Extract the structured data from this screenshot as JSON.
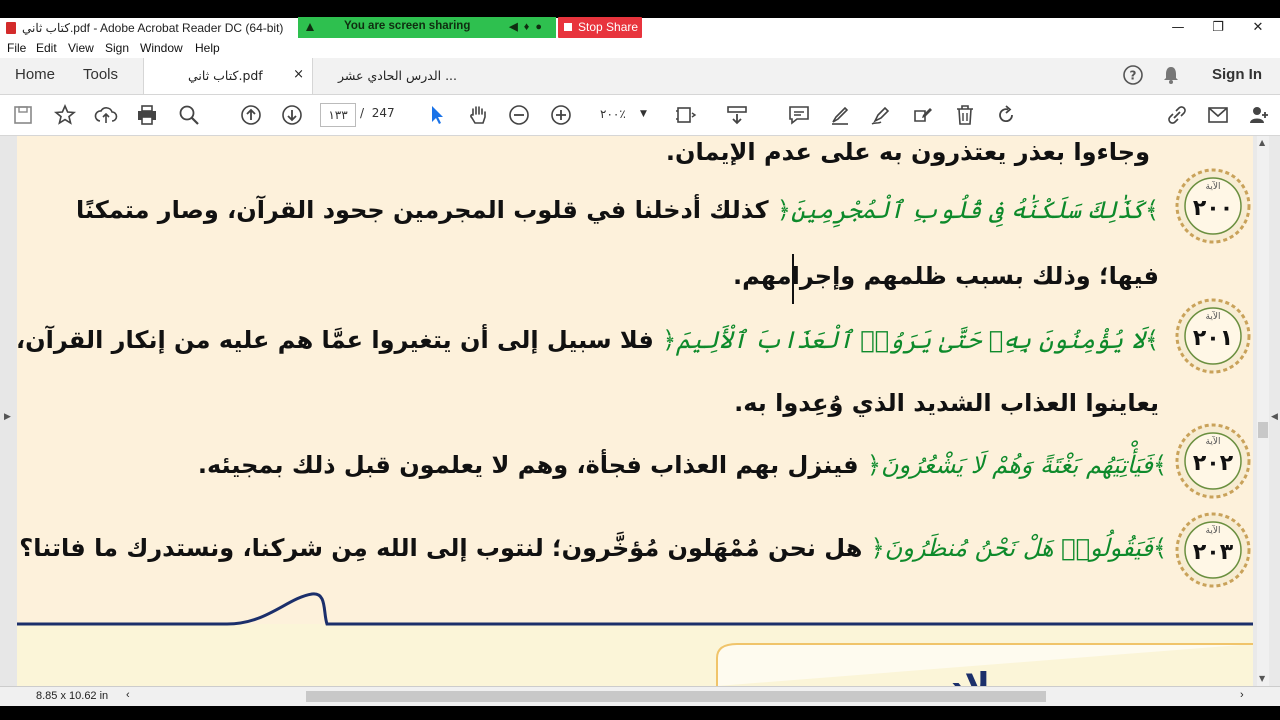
{
  "window": {
    "title": "كتاب ثاني.pdf - Adobe Acrobat Reader DC (64-bit)"
  },
  "screen_share": {
    "message": "You are screen sharing",
    "stop_label": "Stop Share"
  },
  "menu": [
    "File",
    "Edit",
    "View",
    "Sign",
    "Window",
    "Help"
  ],
  "tabs": {
    "home": "Home",
    "tools": "Tools",
    "documents": [
      {
        "label": "كتاب ثاني.pdf",
        "active": true,
        "close": "×"
      },
      {
        "label": "الدرس الحادي عشر ...",
        "active": false
      }
    ],
    "sign_in": "Sign In"
  },
  "toolbar": {
    "current_page": "١٣٣",
    "page_separator": "/",
    "total_pages": "247",
    "zoom": "٢٠٠٪"
  },
  "document": {
    "lines": [
      {
        "text": "وجاءوا بعذر يعتذرون به على عدم الإيمان."
      },
      {
        "quran": "كَذَٰلِكَ سَلَكْنَٰهُ فِى قُلُوبِ ٱلْمُجْرِمِينَ",
        "text": "كذلك أدخلنا في قلوب المجرمين جحود القرآن، وصار متمكنًا"
      },
      {
        "text": "فيها؛ وذلك بسبب ظلمهم وإجرامهم."
      },
      {
        "quran": "لَا يُؤْمِنُونَ بِهِۦ حَتَّىٰ يَرَوُا۟ ٱلْعَذَابَ ٱلْأَلِيمَ",
        "text": "فلا سبيل إلى أن يتغيروا عمَّا هم عليه من إنكار القرآن، حتى"
      },
      {
        "text": "يعاينوا العذاب الشديد الذي وُعِدوا به."
      },
      {
        "quran": "فَيَأْتِيَهُم بَغْتَةً وَهُمْ لَا يَشْعُرُونَ",
        "text": "فينزل بهم العذاب فجأة، وهم لا يعلمون قبل ذلك بمجيئه."
      },
      {
        "quran": "فَيَقُولُوا۟ هَلْ نَحْنُ مُنظَرُونَ",
        "text": "هل نحن مُمْهَلون مُؤخَّرون؛ لنتوب إلى الله مِن شركنا، ونستدرك ما فاتنا؟"
      }
    ],
    "bracket_open": "﴿",
    "bracket_close": "﴾",
    "verses": [
      {
        "label": "الآية",
        "number": "٢٠٠"
      },
      {
        "label": "الآية",
        "number": "٢٠١"
      },
      {
        "label": "الآية",
        "number": "٢٠٢"
      },
      {
        "label": "الآية",
        "number": "٢٠٣"
      }
    ],
    "next_heading": "ميلاد"
  },
  "status": {
    "page_size": "8.85 x 10.62 in"
  },
  "colors": {
    "accent_green": "#0e8a2b",
    "page_bg": "#fdf1db",
    "divider_navy": "#1b2f6b",
    "share_green": "#2ec04f",
    "stop_red": "#e8343d"
  }
}
